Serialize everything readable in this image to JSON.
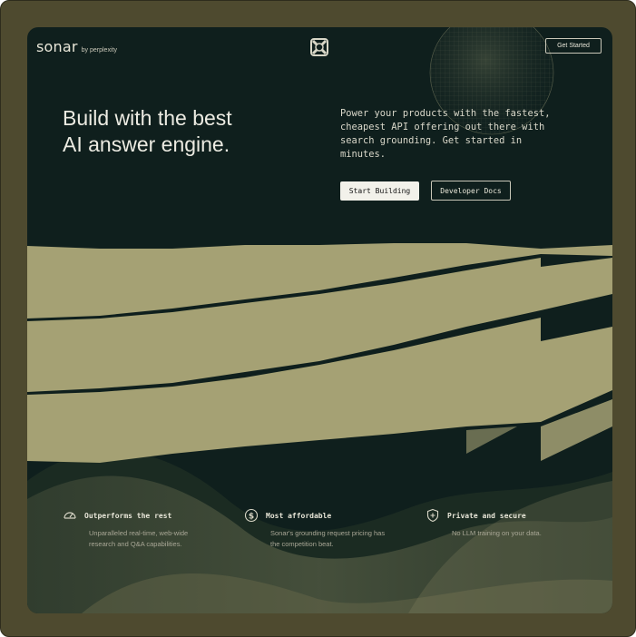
{
  "brand": {
    "name": "sonar",
    "byline": "by perplexity"
  },
  "nav": {
    "get_started": "Get Started"
  },
  "hero": {
    "headline_lines": [
      "Build with the best",
      "AI answer engine."
    ],
    "tagline_lines": [
      "Power your products with the fastest,",
      "cheapest API offering out there with",
      "search grounding. Get started in",
      "minutes."
    ],
    "primary_button": "Start Building",
    "secondary_button": "Developer Docs"
  },
  "features": [
    {
      "icon": "speedometer-icon",
      "title": "Outperforms the rest",
      "desc_lines": [
        "Unparalleled real-time, web-wide",
        "research and Q&A capabilities."
      ]
    },
    {
      "icon": "dollar-coin-icon",
      "title": "Most affordable",
      "desc_lines": [
        "Sonar's grounding request pricing has",
        "the competition beat."
      ]
    },
    {
      "icon": "shield-plus-icon",
      "title": "Private and secure",
      "desc_lines": [
        "No LLM training on your data."
      ]
    }
  ],
  "colors": {
    "frame": "#4e4a2f",
    "panel": "#0f1f1d",
    "olive": "#a5a174",
    "text": "#ecebe2"
  }
}
